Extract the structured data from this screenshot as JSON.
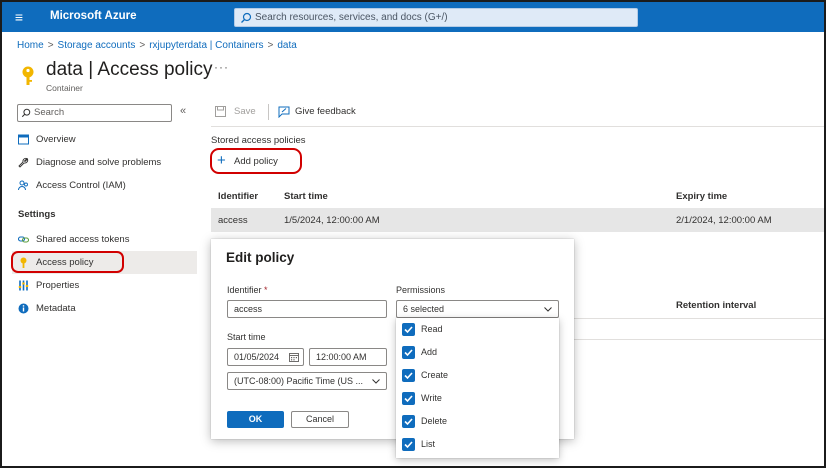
{
  "topbar": {
    "menu_icon": "hamburger-icon",
    "brand": "Microsoft Azure",
    "search_placeholder": "Search resources, services, and docs (G+/)"
  },
  "breadcrumb": [
    "Home",
    "Storage accounts",
    "rxjupyterdata | Containers",
    "data"
  ],
  "page": {
    "title": "data | Access policy",
    "subtitle": "Container",
    "more": "···"
  },
  "sidebar": {
    "search_placeholder": "Search",
    "collapse": "«",
    "items": [
      {
        "label": "Overview",
        "icon": "overview-icon"
      },
      {
        "label": "Diagnose and solve problems",
        "icon": "wrench-icon"
      },
      {
        "label": "Access Control (IAM)",
        "icon": "people-icon"
      }
    ],
    "settings_heading": "Settings",
    "settings_items": [
      {
        "label": "Shared access tokens",
        "icon": "link-icon"
      },
      {
        "label": "Access policy",
        "icon": "key-icon"
      },
      {
        "label": "Properties",
        "icon": "properties-icon"
      },
      {
        "label": "Metadata",
        "icon": "info-icon"
      }
    ],
    "active": "Access policy"
  },
  "toolbar": {
    "save_label": "Save",
    "feedback_label": "Give feedback"
  },
  "stored_policies": {
    "label": "Stored access policies",
    "add_label": "Add policy",
    "columns": [
      "Identifier",
      "Start time",
      "Expiry time"
    ],
    "rows": [
      {
        "identifier": "access",
        "start": "1/5/2024, 12:00:00 AM",
        "expiry": "2/1/2024, 12:00:00 AM"
      }
    ]
  },
  "immutable": {
    "retention_header": "Retention interval"
  },
  "dialog": {
    "title": "Edit policy",
    "identifier_label": "Identifier",
    "identifier_required": "*",
    "identifier_value": "access",
    "start_label": "Start time",
    "start_date": "01/05/2024",
    "start_time": "12:00:00 AM",
    "timezone": "(UTC-08:00) Pacific Time (US ...",
    "permissions_label": "Permissions",
    "permissions_value": "6 selected",
    "permissions": [
      {
        "label": "Read",
        "checked": true
      },
      {
        "label": "Add",
        "checked": true
      },
      {
        "label": "Create",
        "checked": true
      },
      {
        "label": "Write",
        "checked": true
      },
      {
        "label": "Delete",
        "checked": true
      },
      {
        "label": "List",
        "checked": true
      }
    ],
    "ok_label": "OK",
    "cancel_label": "Cancel"
  },
  "colors": {
    "accent": "#0f6cbd",
    "highlight": "#d10000",
    "key": "#f2b600"
  }
}
